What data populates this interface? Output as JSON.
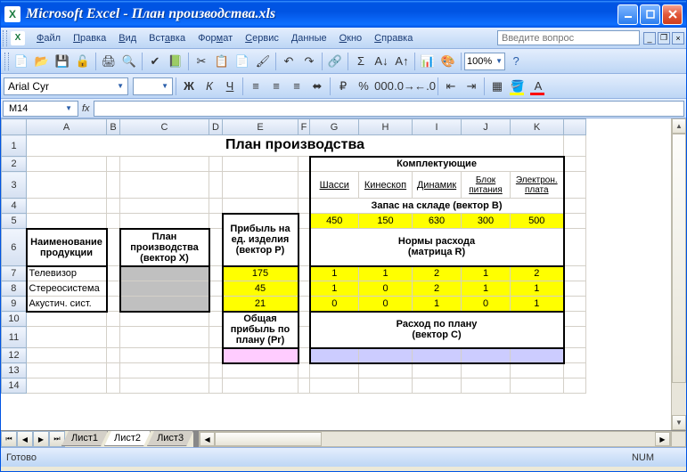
{
  "window": {
    "title": "Microsoft Excel - План производства.xls",
    "minimize": "_",
    "maximize": "□",
    "close": "X"
  },
  "menu": {
    "file": "Файл",
    "edit": "Правка",
    "view": "Вид",
    "insert": "Вставка",
    "format": "Формат",
    "tools": "Сервис",
    "data": "Данные",
    "window": "Окно",
    "help": "Справка",
    "help_placeholder": "Введите вопрос"
  },
  "toolbar": {
    "zoom": "100%"
  },
  "format": {
    "font": "Arial Cyr",
    "size": ""
  },
  "formula_bar": {
    "name_box": "M14",
    "fx": "fx",
    "formula": ""
  },
  "columns": [
    "A",
    "B",
    "C",
    "D",
    "E",
    "F",
    "G",
    "H",
    "I",
    "J",
    "K"
  ],
  "rows": [
    "1",
    "2",
    "3",
    "4",
    "5",
    "6",
    "7",
    "8",
    "9",
    "10",
    "11",
    "12",
    "13",
    "14"
  ],
  "sheet": {
    "title": "План производства",
    "product_name_label": "Наименование продукции",
    "plan_label_l1": "План",
    "plan_label_l2": "производства",
    "plan_label_l3": "(вектор X)",
    "profit_label_l1": "Прибыль на",
    "profit_label_l2": "ед. изделия",
    "profit_label_l3": "(вектор P)",
    "components_label": "Комплектующие",
    "comp_headers": [
      "Шасси",
      "Кинескоп",
      "Динамик",
      "Блок питания",
      "Электрон. плата"
    ],
    "stock_label": "Запас на складе (вектор B)",
    "stock_values": [
      "450",
      "150",
      "630",
      "300",
      "500"
    ],
    "norms_label_l1": "Нормы расхода",
    "norms_label_l2": "(матрица R)",
    "products": [
      "Телевизор",
      "Стереосистема",
      "Акустич. сист."
    ],
    "profits": [
      "175",
      "45",
      "21"
    ],
    "matrix": [
      [
        "1",
        "1",
        "2",
        "1",
        "2"
      ],
      [
        "1",
        "0",
        "2",
        "1",
        "1"
      ],
      [
        "0",
        "0",
        "1",
        "0",
        "1"
      ]
    ],
    "total_profit_l1": "Общая",
    "total_profit_l2": "прибыль по",
    "total_profit_l3": "плану (Pr)",
    "plan_usage_l1": "Расход по плану",
    "plan_usage_l2": "(вектор C)"
  },
  "tabs": {
    "sheet1": "Лист1",
    "sheet2": "Лист2",
    "sheet3": "Лист3"
  },
  "status": {
    "ready": "Готово",
    "num": "NUM"
  }
}
